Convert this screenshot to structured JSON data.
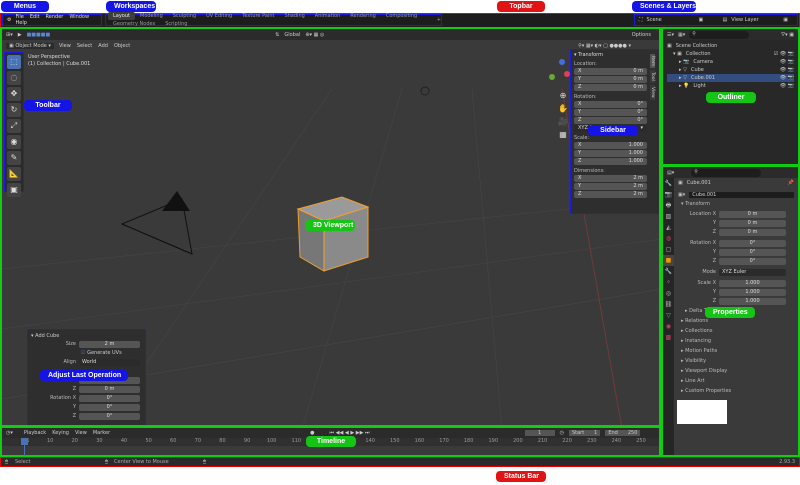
{
  "callouts": {
    "menus": "Menus",
    "workspaces": "Workspaces",
    "topbar": "Topbar",
    "scenes": "Scenes & Layers",
    "toolbar": "Toolbar",
    "sidebar": "Sidebar",
    "viewport": "3D Viewport",
    "outliner": "Outliner",
    "properties": "Properties",
    "adjust": "Adjust Last Operation",
    "timeline": "Timeline",
    "statusbar": "Status Bar"
  },
  "menus": [
    "File",
    "Edit",
    "Render",
    "Window",
    "Help"
  ],
  "workspaces": [
    "Layout",
    "Modeling",
    "Sculpting",
    "UV Editing",
    "Texture Paint",
    "Shading",
    "Animation",
    "Rendering",
    "Compositing",
    "Geometry Nodes",
    "Scripting"
  ],
  "scene": {
    "scene": "Scene",
    "view_layer": "View Layer"
  },
  "viewport": {
    "mode": "Object Mode",
    "menus": [
      "View",
      "Select",
      "Add",
      "Object"
    ],
    "orientation": "Global",
    "options": "Options",
    "info1": "User Perspective",
    "info2": "(1) Collection | Cube.001"
  },
  "sidebar": {
    "tabs": [
      "Item",
      "Tool",
      "View"
    ],
    "title": "Transform",
    "location": "Location:",
    "rotation": "Rotation:",
    "scale": "Scale:",
    "dimensions": "Dimensions:",
    "mode": "XYZ Euler",
    "loc": [
      "0 m",
      "0 m",
      "0 m"
    ],
    "rot": [
      "0°",
      "0°",
      "0°"
    ],
    "scl": [
      "1.000",
      "1.000",
      "1.000"
    ],
    "dim": [
      "2 m",
      "2 m",
      "2 m"
    ],
    "axes": [
      "X",
      "Y",
      "Z"
    ]
  },
  "outliner": {
    "root": "Scene Collection",
    "collection": "Collection",
    "items": [
      "Camera",
      "Cube",
      "Cube.001",
      "Light"
    ]
  },
  "properties": {
    "object": "Cube.001",
    "name": "Cube.001",
    "transform": "Transform",
    "location_x": "Location X",
    "rotation_x": "Rotation X",
    "scale_x": "Scale X",
    "y": "Y",
    "z": "Z",
    "mode_label": "Mode",
    "mode": "XYZ Euler",
    "loc": [
      "0 m",
      "0 m",
      "0 m"
    ],
    "rot": [
      "0°",
      "0°",
      "0°"
    ],
    "scl": [
      "1.000",
      "1.000",
      "1.000"
    ],
    "delta": "Delta Transform",
    "sections": [
      "Relations",
      "Collections",
      "Instancing",
      "Motion Paths",
      "Visibility",
      "Viewport Display",
      "Line Art",
      "Custom Properties"
    ]
  },
  "adjust": {
    "title": "Add Cube",
    "size_label": "Size",
    "size": "2 m",
    "gen_uvs": "Generate UVs",
    "align_label": "Align",
    "align": "World",
    "loc_z": "0 m",
    "loc_y": "0 m",
    "rotation_x": "Rotation X",
    "y": "Y",
    "z": "Z",
    "rot": [
      "0°",
      "0°",
      "0°"
    ]
  },
  "timeline": {
    "menus": [
      "Playback",
      "Keying",
      "View",
      "Marker"
    ],
    "current": "1",
    "start_label": "Start",
    "start": "1",
    "end_label": "End",
    "end": "250",
    "ticks": [
      "1",
      "10",
      "20",
      "30",
      "40",
      "50",
      "60",
      "70",
      "80",
      "90",
      "100",
      "110",
      "120",
      "130",
      "140",
      "150",
      "160",
      "170",
      "180",
      "190",
      "200",
      "210",
      "220",
      "230",
      "240",
      "250"
    ]
  },
  "status": {
    "select": "Select",
    "center": "Center View to Mouse",
    "version": "2.93.3"
  }
}
